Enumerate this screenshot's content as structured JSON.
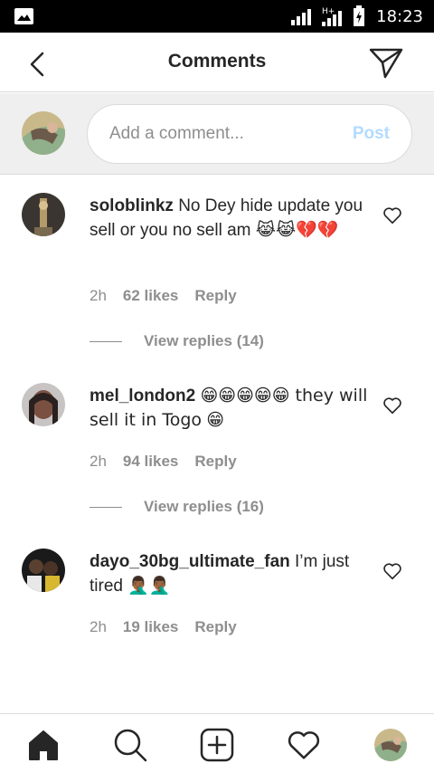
{
  "status_bar": {
    "network": "H+",
    "time": "18:23"
  },
  "header": {
    "title": "Comments"
  },
  "composer": {
    "placeholder": "Add a comment...",
    "post_label": "Post"
  },
  "comments": [
    {
      "username": "soloblinkz",
      "text": "No Dey hide update you sell or you no sell am",
      "emojis": "😹😹💔💔",
      "time": "2h",
      "likes": "62 likes",
      "reply_label": "Reply",
      "view_replies": "View replies (14)"
    },
    {
      "username": "mel_london2",
      "text_before": "😁😁😁😁😁 they will sell it in Togo",
      "emojis": "😁",
      "time": "2h",
      "likes": "94 likes",
      "reply_label": "Reply",
      "view_replies": "View replies (16)"
    },
    {
      "username": "dayo_30bg_ultimate_fan",
      "text": "I’m just tired",
      "emojis": "🤦🏾‍♂️🤦🏾‍♂️",
      "time": "2h",
      "likes": "19 likes",
      "reply_label": "Reply"
    }
  ],
  "icons": {
    "back": "chevron-left-icon",
    "send": "paper-plane-icon",
    "like": "heart-outline-icon",
    "nav": [
      "home-icon",
      "search-icon",
      "add-post-icon",
      "activity-heart-icon",
      "profile-avatar"
    ]
  },
  "colors": {
    "post_disabled": "#b3dbff",
    "muted": "#8e8e8e",
    "text": "#262626",
    "divider": "#dbdbdb"
  }
}
